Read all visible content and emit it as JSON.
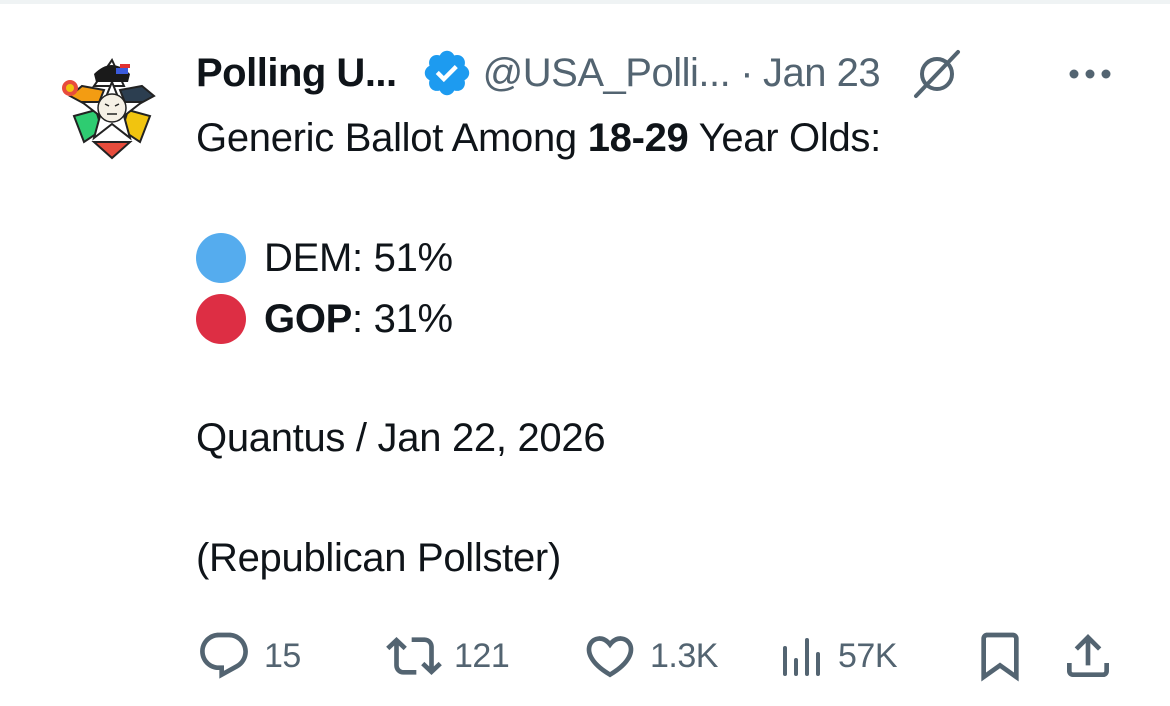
{
  "author": {
    "display_name": "Polling U...",
    "handle": "@USA_Polli...",
    "separator": "·",
    "timestamp": "Jan 23"
  },
  "tweet": {
    "title_prefix": "Generic Ballot Among ",
    "title_bold": "18-29",
    "title_suffix": " Year Olds:",
    "results": [
      {
        "party": "DEM",
        "party_suffix": ": 51%",
        "color": "#55acee",
        "bold": false
      },
      {
        "party": "GOP",
        "party_suffix": ": 31%",
        "color": "#dd2e44",
        "bold": true
      }
    ],
    "source_line": "Quantus / Jan 22, 2026",
    "note_line": "(Republican Pollster)"
  },
  "actions": {
    "replies": "15",
    "reposts": "121",
    "likes": "1.3K",
    "views": "57K"
  },
  "colors": {
    "text": "#0f1419",
    "muted": "#536471",
    "verified": "#1d9bf0",
    "dem": "#55acee",
    "gop": "#dd2e44"
  },
  "icons": [
    "avatar",
    "verified-badge-icon",
    "grok-icon",
    "more-icon",
    "reply-icon",
    "repost-icon",
    "like-icon",
    "views-icon",
    "bookmark-icon",
    "share-icon"
  ]
}
